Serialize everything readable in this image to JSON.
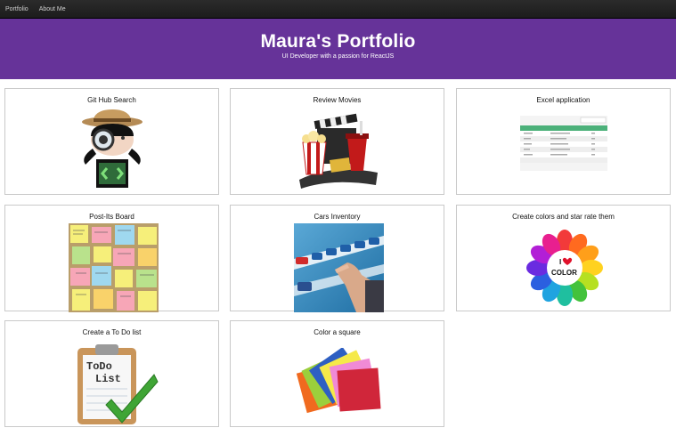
{
  "nav": {
    "items": [
      {
        "label": "Portfolio"
      },
      {
        "label": "About Me"
      }
    ]
  },
  "hero": {
    "title": "Maura's Portfolio",
    "subtitle": "UI Developer with a passion for ReactJS"
  },
  "colors": {
    "hero_bg": "#663399",
    "nav_bg": "#1c1c1c",
    "card_border": "#c9c9c9"
  },
  "cards": [
    {
      "title": "Git Hub Search",
      "icon": "github-octocat-detective-icon"
    },
    {
      "title": "Review Movies",
      "icon": "movie-clapper-popcorn-icon"
    },
    {
      "title": "Excel application",
      "icon": "spreadsheet-table-icon"
    },
    {
      "title": "Post-Its Board",
      "icon": "sticky-notes-board-icon"
    },
    {
      "title": "Cars Inventory",
      "icon": "toy-cars-shelf-icon"
    },
    {
      "title": "Create colors and star rate them",
      "icon": "color-flower-wheel-icon"
    },
    {
      "title": "Create a To Do list",
      "icon": "todo-clipboard-check-icon"
    },
    {
      "title": "Color a square",
      "icon": "paper-squares-icon"
    }
  ],
  "thumb_text": {
    "todo": "ToDo",
    "list": "List",
    "i_love": "I",
    "color": "COLOR"
  }
}
